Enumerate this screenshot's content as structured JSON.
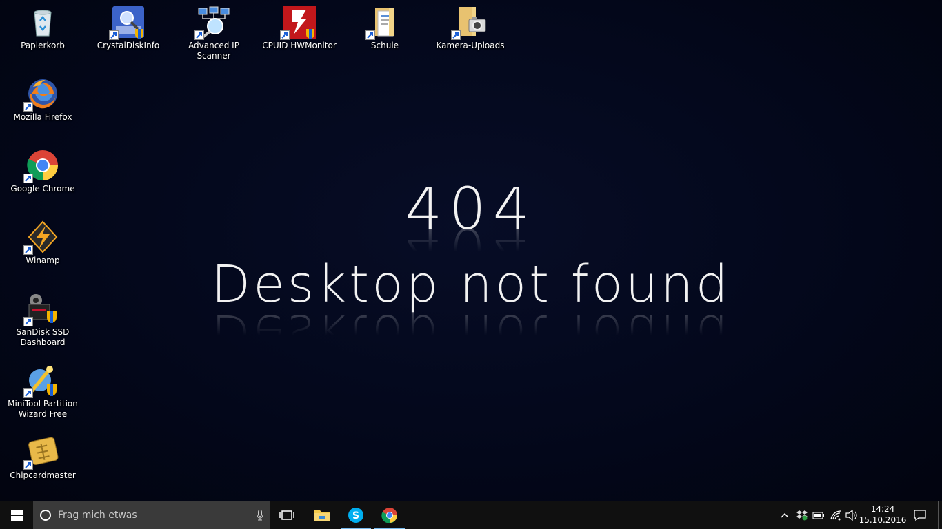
{
  "wallpaper": {
    "line1": "404",
    "line2": "Desktop not found"
  },
  "desktop_icons": [
    {
      "label": "Papierkorb"
    },
    {
      "label": "CrystalDiskInfo"
    },
    {
      "label": "Advanced IP Scanner"
    },
    {
      "label": "CPUID HWMonitor"
    },
    {
      "label": "Schule"
    },
    {
      "label": "Kamera-Uploads"
    },
    {
      "label": "Mozilla Firefox"
    },
    {
      "label": "Google Chrome"
    },
    {
      "label": "Winamp"
    },
    {
      "label": "SanDisk SSD Dashboard"
    },
    {
      "label": "MiniTool Partition Wizard Free"
    },
    {
      "label": "Chipcardmaster"
    }
  ],
  "taskbar": {
    "search_placeholder": "Frag mich etwas",
    "pinned": [
      "task-view",
      "file-explorer",
      "skype",
      "google-chrome"
    ],
    "active_app": "skype",
    "clock": {
      "time": "14:24",
      "date": "15.10.2016"
    }
  },
  "colors": {
    "desktop_bg": "#03071a",
    "taskbar_bg": "#101010",
    "search_bg": "#3a3a3a",
    "accent": "#76b9ed"
  }
}
